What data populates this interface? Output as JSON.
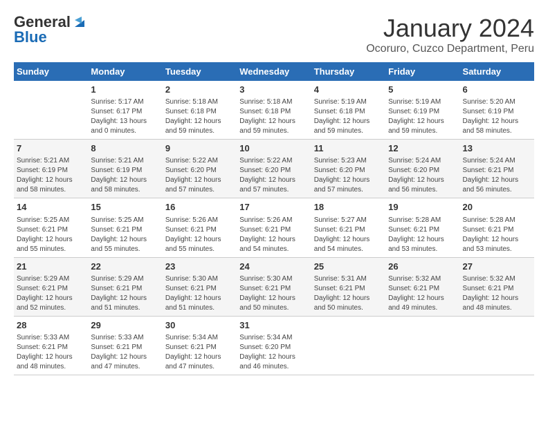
{
  "header": {
    "logo_line1": "General",
    "logo_line2": "Blue",
    "main_title": "January 2024",
    "subtitle": "Ocoruro, Cuzco Department, Peru"
  },
  "calendar": {
    "weekdays": [
      "Sunday",
      "Monday",
      "Tuesday",
      "Wednesday",
      "Thursday",
      "Friday",
      "Saturday"
    ],
    "weeks": [
      [
        {
          "day": "",
          "info": ""
        },
        {
          "day": "1",
          "info": "Sunrise: 5:17 AM\nSunset: 6:17 PM\nDaylight: 13 hours\nand 0 minutes."
        },
        {
          "day": "2",
          "info": "Sunrise: 5:18 AM\nSunset: 6:18 PM\nDaylight: 12 hours\nand 59 minutes."
        },
        {
          "day": "3",
          "info": "Sunrise: 5:18 AM\nSunset: 6:18 PM\nDaylight: 12 hours\nand 59 minutes."
        },
        {
          "day": "4",
          "info": "Sunrise: 5:19 AM\nSunset: 6:18 PM\nDaylight: 12 hours\nand 59 minutes."
        },
        {
          "day": "5",
          "info": "Sunrise: 5:19 AM\nSunset: 6:19 PM\nDaylight: 12 hours\nand 59 minutes."
        },
        {
          "day": "6",
          "info": "Sunrise: 5:20 AM\nSunset: 6:19 PM\nDaylight: 12 hours\nand 58 minutes."
        }
      ],
      [
        {
          "day": "7",
          "info": "Sunrise: 5:21 AM\nSunset: 6:19 PM\nDaylight: 12 hours\nand 58 minutes."
        },
        {
          "day": "8",
          "info": "Sunrise: 5:21 AM\nSunset: 6:19 PM\nDaylight: 12 hours\nand 58 minutes."
        },
        {
          "day": "9",
          "info": "Sunrise: 5:22 AM\nSunset: 6:20 PM\nDaylight: 12 hours\nand 57 minutes."
        },
        {
          "day": "10",
          "info": "Sunrise: 5:22 AM\nSunset: 6:20 PM\nDaylight: 12 hours\nand 57 minutes."
        },
        {
          "day": "11",
          "info": "Sunrise: 5:23 AM\nSunset: 6:20 PM\nDaylight: 12 hours\nand 57 minutes."
        },
        {
          "day": "12",
          "info": "Sunrise: 5:24 AM\nSunset: 6:20 PM\nDaylight: 12 hours\nand 56 minutes."
        },
        {
          "day": "13",
          "info": "Sunrise: 5:24 AM\nSunset: 6:21 PM\nDaylight: 12 hours\nand 56 minutes."
        }
      ],
      [
        {
          "day": "14",
          "info": "Sunrise: 5:25 AM\nSunset: 6:21 PM\nDaylight: 12 hours\nand 55 minutes."
        },
        {
          "day": "15",
          "info": "Sunrise: 5:25 AM\nSunset: 6:21 PM\nDaylight: 12 hours\nand 55 minutes."
        },
        {
          "day": "16",
          "info": "Sunrise: 5:26 AM\nSunset: 6:21 PM\nDaylight: 12 hours\nand 55 minutes."
        },
        {
          "day": "17",
          "info": "Sunrise: 5:26 AM\nSunset: 6:21 PM\nDaylight: 12 hours\nand 54 minutes."
        },
        {
          "day": "18",
          "info": "Sunrise: 5:27 AM\nSunset: 6:21 PM\nDaylight: 12 hours\nand 54 minutes."
        },
        {
          "day": "19",
          "info": "Sunrise: 5:28 AM\nSunset: 6:21 PM\nDaylight: 12 hours\nand 53 minutes."
        },
        {
          "day": "20",
          "info": "Sunrise: 5:28 AM\nSunset: 6:21 PM\nDaylight: 12 hours\nand 53 minutes."
        }
      ],
      [
        {
          "day": "21",
          "info": "Sunrise: 5:29 AM\nSunset: 6:21 PM\nDaylight: 12 hours\nand 52 minutes."
        },
        {
          "day": "22",
          "info": "Sunrise: 5:29 AM\nSunset: 6:21 PM\nDaylight: 12 hours\nand 51 minutes."
        },
        {
          "day": "23",
          "info": "Sunrise: 5:30 AM\nSunset: 6:21 PM\nDaylight: 12 hours\nand 51 minutes."
        },
        {
          "day": "24",
          "info": "Sunrise: 5:30 AM\nSunset: 6:21 PM\nDaylight: 12 hours\nand 50 minutes."
        },
        {
          "day": "25",
          "info": "Sunrise: 5:31 AM\nSunset: 6:21 PM\nDaylight: 12 hours\nand 50 minutes."
        },
        {
          "day": "26",
          "info": "Sunrise: 5:32 AM\nSunset: 6:21 PM\nDaylight: 12 hours\nand 49 minutes."
        },
        {
          "day": "27",
          "info": "Sunrise: 5:32 AM\nSunset: 6:21 PM\nDaylight: 12 hours\nand 48 minutes."
        }
      ],
      [
        {
          "day": "28",
          "info": "Sunrise: 5:33 AM\nSunset: 6:21 PM\nDaylight: 12 hours\nand 48 minutes."
        },
        {
          "day": "29",
          "info": "Sunrise: 5:33 AM\nSunset: 6:21 PM\nDaylight: 12 hours\nand 47 minutes."
        },
        {
          "day": "30",
          "info": "Sunrise: 5:34 AM\nSunset: 6:21 PM\nDaylight: 12 hours\nand 47 minutes."
        },
        {
          "day": "31",
          "info": "Sunrise: 5:34 AM\nSunset: 6:20 PM\nDaylight: 12 hours\nand 46 minutes."
        },
        {
          "day": "",
          "info": ""
        },
        {
          "day": "",
          "info": ""
        },
        {
          "day": "",
          "info": ""
        }
      ]
    ]
  }
}
